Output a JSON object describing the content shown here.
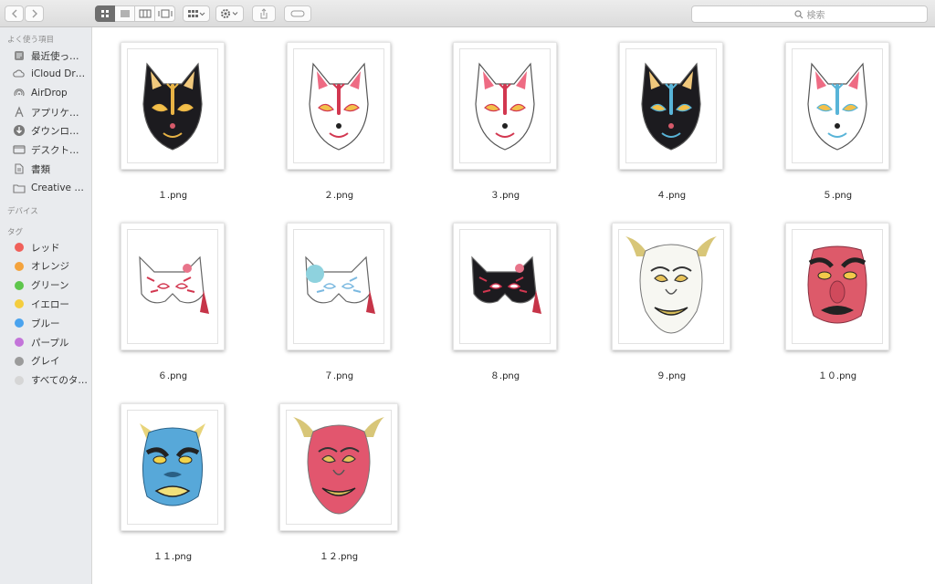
{
  "search": {
    "placeholder": "検索"
  },
  "sidebar": {
    "favorites_header": "よく使う項目",
    "favorites": [
      {
        "label": "最近使った…",
        "icon": "recents-icon"
      },
      {
        "label": "iCloud Drive",
        "icon": "cloud-icon"
      },
      {
        "label": "AirDrop",
        "icon": "airdrop-icon"
      },
      {
        "label": "アプリケー…",
        "icon": "applications-icon"
      },
      {
        "label": "ダウンロード",
        "icon": "downloads-icon"
      },
      {
        "label": "デスクトップ",
        "icon": "desktop-icon"
      },
      {
        "label": "書類",
        "icon": "documents-icon"
      },
      {
        "label": "Creative Cl…",
        "icon": "folder-icon"
      }
    ],
    "devices_header": "デバイス",
    "tags_header": "タグ",
    "tags": [
      {
        "label": "レッド",
        "color": "#f0605a"
      },
      {
        "label": "オレンジ",
        "color": "#f4a33d"
      },
      {
        "label": "グリーン",
        "color": "#5ec64c"
      },
      {
        "label": "イエロー",
        "color": "#f4cd3e"
      },
      {
        "label": "ブルー",
        "color": "#4aa3ee"
      },
      {
        "label": "パープル",
        "color": "#c374d9"
      },
      {
        "label": "グレイ",
        "color": "#9b9b9b"
      },
      {
        "label": "すべてのタ…",
        "color": "#d6d6d6"
      }
    ]
  },
  "files": [
    {
      "name": "１.png",
      "mask": "fox",
      "style": "black"
    },
    {
      "name": "２.png",
      "mask": "fox",
      "style": "white-red"
    },
    {
      "name": "３.png",
      "mask": "fox",
      "style": "white-plain"
    },
    {
      "name": "４.png",
      "mask": "fox",
      "style": "black-blue"
    },
    {
      "name": "５.png",
      "mask": "fox",
      "style": "white-blue"
    },
    {
      "name": "６.png",
      "mask": "half-fox",
      "style": "white-red"
    },
    {
      "name": "７.png",
      "mask": "half-fox",
      "style": "white-flower"
    },
    {
      "name": "８.png",
      "mask": "half-fox",
      "style": "black"
    },
    {
      "name": "９.png",
      "mask": "hannya",
      "style": "white"
    },
    {
      "name": "１０.png",
      "mask": "tengu",
      "style": "red"
    },
    {
      "name": "１１.png",
      "mask": "oni",
      "style": "blue"
    },
    {
      "name": "１２.png",
      "mask": "hannya",
      "style": "red"
    }
  ]
}
